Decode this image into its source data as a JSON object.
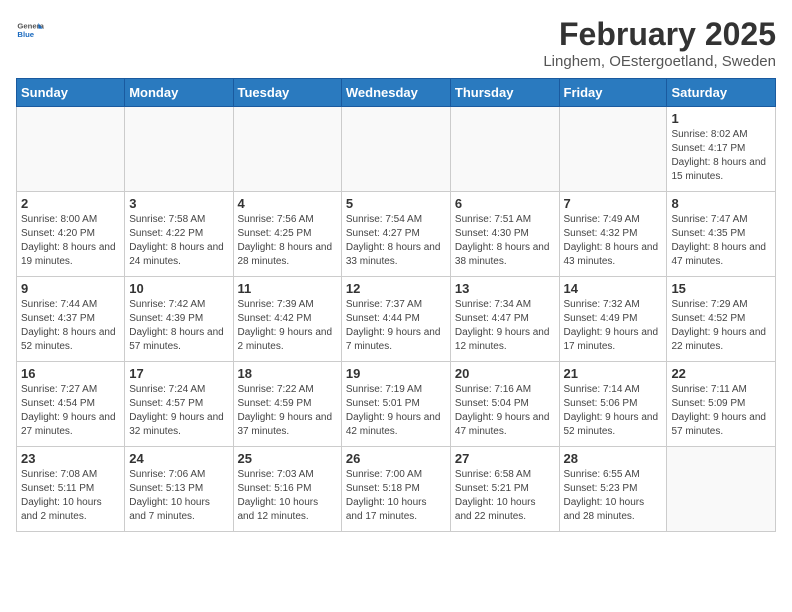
{
  "header": {
    "logo_general": "General",
    "logo_blue": "Blue",
    "month_title": "February 2025",
    "location": "Linghem, OEstergoetland, Sweden"
  },
  "days_of_week": [
    "Sunday",
    "Monday",
    "Tuesday",
    "Wednesday",
    "Thursday",
    "Friday",
    "Saturday"
  ],
  "weeks": [
    [
      {
        "day": "",
        "info": ""
      },
      {
        "day": "",
        "info": ""
      },
      {
        "day": "",
        "info": ""
      },
      {
        "day": "",
        "info": ""
      },
      {
        "day": "",
        "info": ""
      },
      {
        "day": "",
        "info": ""
      },
      {
        "day": "1",
        "info": "Sunrise: 8:02 AM\nSunset: 4:17 PM\nDaylight: 8 hours and 15 minutes."
      }
    ],
    [
      {
        "day": "2",
        "info": "Sunrise: 8:00 AM\nSunset: 4:20 PM\nDaylight: 8 hours and 19 minutes."
      },
      {
        "day": "3",
        "info": "Sunrise: 7:58 AM\nSunset: 4:22 PM\nDaylight: 8 hours and 24 minutes."
      },
      {
        "day": "4",
        "info": "Sunrise: 7:56 AM\nSunset: 4:25 PM\nDaylight: 8 hours and 28 minutes."
      },
      {
        "day": "5",
        "info": "Sunrise: 7:54 AM\nSunset: 4:27 PM\nDaylight: 8 hours and 33 minutes."
      },
      {
        "day": "6",
        "info": "Sunrise: 7:51 AM\nSunset: 4:30 PM\nDaylight: 8 hours and 38 minutes."
      },
      {
        "day": "7",
        "info": "Sunrise: 7:49 AM\nSunset: 4:32 PM\nDaylight: 8 hours and 43 minutes."
      },
      {
        "day": "8",
        "info": "Sunrise: 7:47 AM\nSunset: 4:35 PM\nDaylight: 8 hours and 47 minutes."
      }
    ],
    [
      {
        "day": "9",
        "info": "Sunrise: 7:44 AM\nSunset: 4:37 PM\nDaylight: 8 hours and 52 minutes."
      },
      {
        "day": "10",
        "info": "Sunrise: 7:42 AM\nSunset: 4:39 PM\nDaylight: 8 hours and 57 minutes."
      },
      {
        "day": "11",
        "info": "Sunrise: 7:39 AM\nSunset: 4:42 PM\nDaylight: 9 hours and 2 minutes."
      },
      {
        "day": "12",
        "info": "Sunrise: 7:37 AM\nSunset: 4:44 PM\nDaylight: 9 hours and 7 minutes."
      },
      {
        "day": "13",
        "info": "Sunrise: 7:34 AM\nSunset: 4:47 PM\nDaylight: 9 hours and 12 minutes."
      },
      {
        "day": "14",
        "info": "Sunrise: 7:32 AM\nSunset: 4:49 PM\nDaylight: 9 hours and 17 minutes."
      },
      {
        "day": "15",
        "info": "Sunrise: 7:29 AM\nSunset: 4:52 PM\nDaylight: 9 hours and 22 minutes."
      }
    ],
    [
      {
        "day": "16",
        "info": "Sunrise: 7:27 AM\nSunset: 4:54 PM\nDaylight: 9 hours and 27 minutes."
      },
      {
        "day": "17",
        "info": "Sunrise: 7:24 AM\nSunset: 4:57 PM\nDaylight: 9 hours and 32 minutes."
      },
      {
        "day": "18",
        "info": "Sunrise: 7:22 AM\nSunset: 4:59 PM\nDaylight: 9 hours and 37 minutes."
      },
      {
        "day": "19",
        "info": "Sunrise: 7:19 AM\nSunset: 5:01 PM\nDaylight: 9 hours and 42 minutes."
      },
      {
        "day": "20",
        "info": "Sunrise: 7:16 AM\nSunset: 5:04 PM\nDaylight: 9 hours and 47 minutes."
      },
      {
        "day": "21",
        "info": "Sunrise: 7:14 AM\nSunset: 5:06 PM\nDaylight: 9 hours and 52 minutes."
      },
      {
        "day": "22",
        "info": "Sunrise: 7:11 AM\nSunset: 5:09 PM\nDaylight: 9 hours and 57 minutes."
      }
    ],
    [
      {
        "day": "23",
        "info": "Sunrise: 7:08 AM\nSunset: 5:11 PM\nDaylight: 10 hours and 2 minutes."
      },
      {
        "day": "24",
        "info": "Sunrise: 7:06 AM\nSunset: 5:13 PM\nDaylight: 10 hours and 7 minutes."
      },
      {
        "day": "25",
        "info": "Sunrise: 7:03 AM\nSunset: 5:16 PM\nDaylight: 10 hours and 12 minutes."
      },
      {
        "day": "26",
        "info": "Sunrise: 7:00 AM\nSunset: 5:18 PM\nDaylight: 10 hours and 17 minutes."
      },
      {
        "day": "27",
        "info": "Sunrise: 6:58 AM\nSunset: 5:21 PM\nDaylight: 10 hours and 22 minutes."
      },
      {
        "day": "28",
        "info": "Sunrise: 6:55 AM\nSunset: 5:23 PM\nDaylight: 10 hours and 28 minutes."
      },
      {
        "day": "",
        "info": ""
      }
    ]
  ]
}
